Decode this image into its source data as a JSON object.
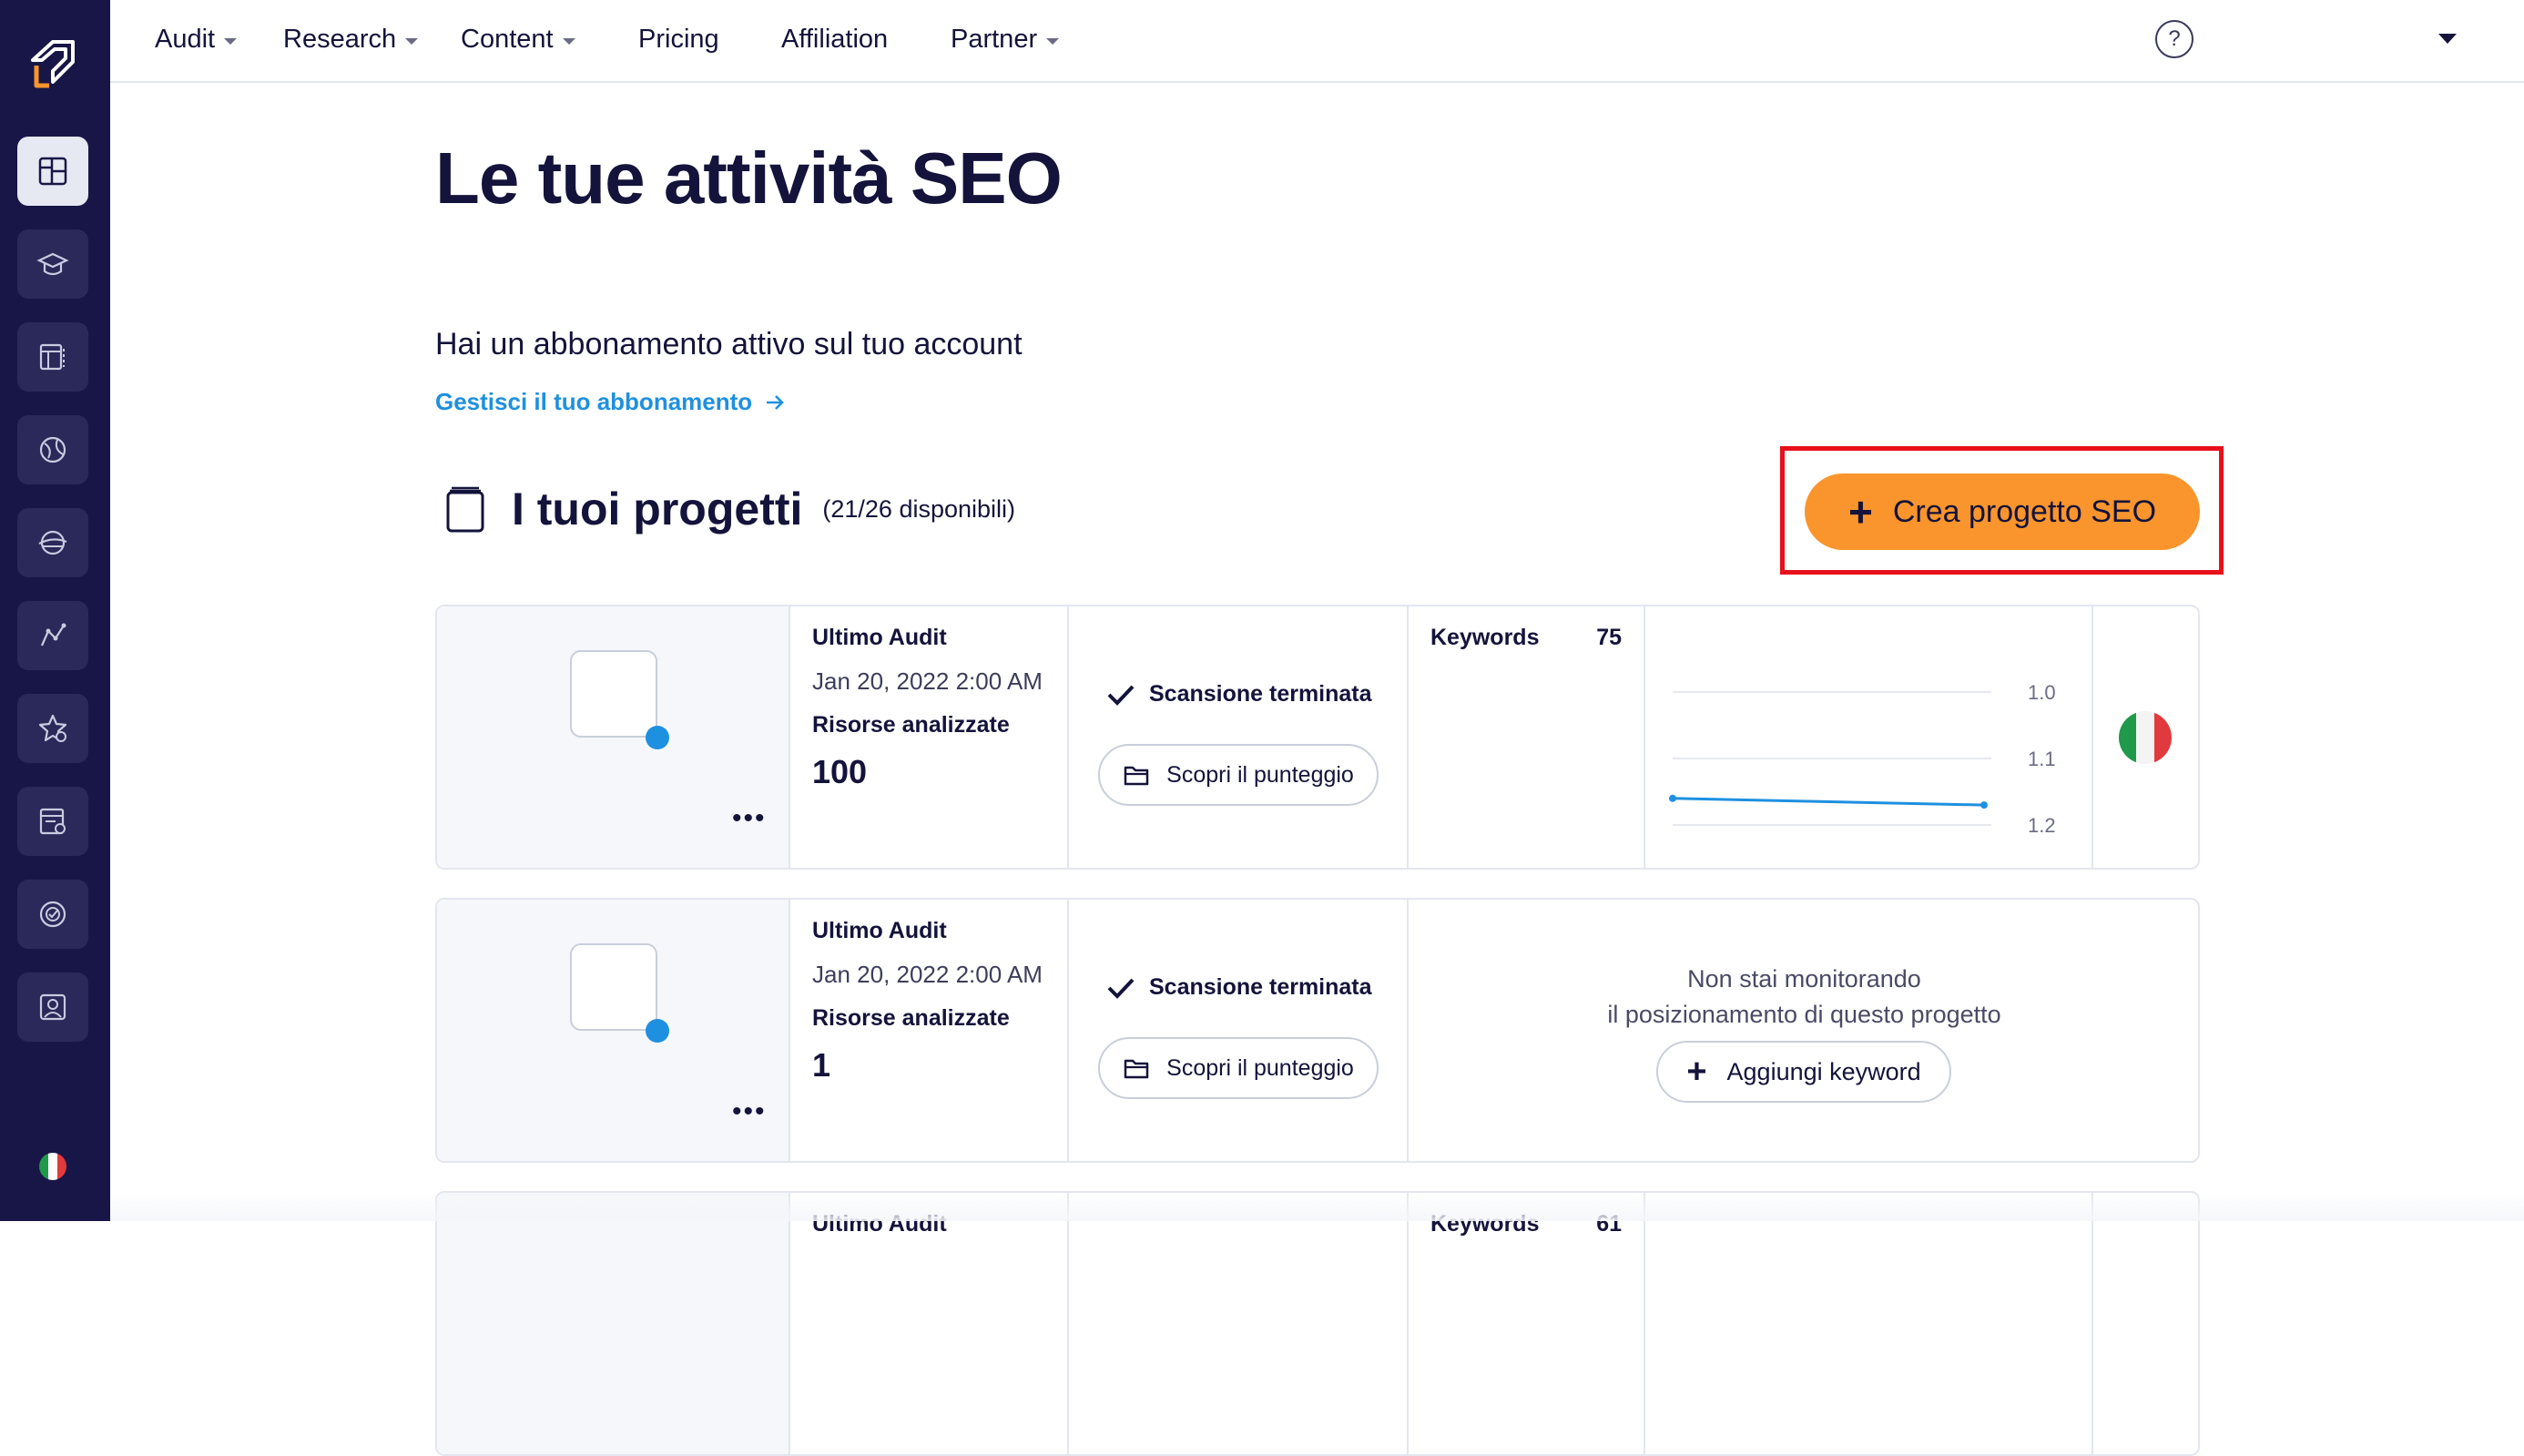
{
  "nav": {
    "items": [
      {
        "label": "Audit",
        "dropdown": true
      },
      {
        "label": "Research",
        "dropdown": true
      },
      {
        "label": "Content",
        "dropdown": true
      },
      {
        "label": "Pricing",
        "dropdown": false
      },
      {
        "label": "Affiliation",
        "dropdown": false
      },
      {
        "label": "Partner",
        "dropdown": true
      }
    ],
    "help_label": "?"
  },
  "sidebar": {
    "icons": [
      "dashboard-icon",
      "education-icon",
      "audit-table-icon",
      "research-globe-icon",
      "content-planet-icon",
      "analytics-graph-icon",
      "favorite-star-icon",
      "reports-icon",
      "monitoring-target-icon",
      "profile-icon"
    ],
    "language_flag": "italian-flag-icon"
  },
  "main": {
    "title": "Le tue attività SEO",
    "subscription_text": "Hai un abbonamento attivo sul tuo account",
    "manage_link": "Gestisci il tuo abbonamento",
    "projects_title": "I tuoi progetti",
    "projects_count": "(21/26 disponibili)",
    "create_button": "Crea progetto SEO",
    "create_button_icon": "+"
  },
  "projects": [
    {
      "audit_label": "Ultimo Audit",
      "audit_date": "Jan 20, 2022 2:00 AM",
      "resources_label": "Risorse analizzate",
      "resources_value": "100",
      "scan_status": "Scansione terminata",
      "score_button": "Scopri il punteggio",
      "keywords_label": "Keywords",
      "keywords_value": "75",
      "chart": {
        "type": "line",
        "y_ticks": [
          "1.0",
          "1.1",
          "1.2"
        ],
        "ylim": [
          1.0,
          1.2
        ],
        "y_inverted": true,
        "values": [
          1.16,
          1.17
        ]
      },
      "flag": "italian-flag-icon"
    },
    {
      "audit_label": "Ultimo Audit",
      "audit_date": "Jan 20, 2022 2:00 AM",
      "resources_label": "Risorse analizzate",
      "resources_value": "1",
      "scan_status": "Scansione terminata",
      "score_button": "Scopri il punteggio",
      "no_monitoring_line1": "Non stai monitorando",
      "no_monitoring_line2": "il posizionamento di questo progetto",
      "add_keyword_button": "Aggiungi keyword",
      "add_keyword_icon": "+"
    },
    {
      "audit_label": "Ultimo Audit",
      "keywords_label": "Keywords",
      "keywords_value": "61"
    }
  ],
  "colors": {
    "sidebar": "#171646",
    "accent_orange": "#f9952c",
    "link_blue": "#1e90e0",
    "highlight_red": "#e8101a",
    "text_dark": "#14133b"
  }
}
